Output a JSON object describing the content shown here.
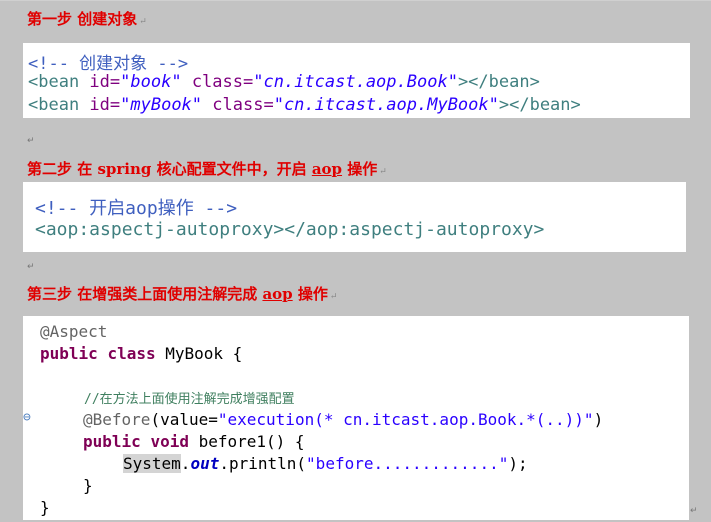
{
  "step1": {
    "heading": "第一步 创建对象",
    "code_comment": "<!-- 创建对象 -->",
    "bean1": {
      "open": "<bean ",
      "id_attr": "id=",
      "id_val": "\"book\"",
      "class_attr": "class=",
      "class_val": "\"cn.itcast.aop.Book\"",
      "close": "></bean>"
    },
    "bean2": {
      "open": "<bean ",
      "id_attr": "id=",
      "id_val": "\"myBook\"",
      "class_attr": "class=",
      "class_val": "\"cn.itcast.aop.MyBook\"",
      "close": "></bean>"
    }
  },
  "step2": {
    "heading_prefix": "第二步 在 spring 核心配置文件中，开启 ",
    "heading_link": "aop",
    "heading_suffix": " 操作",
    "code_comment": "<!-- 开启aop操作 -->",
    "code_line": "<aop:aspectj-autoproxy></aop:aspectj-autoproxy>"
  },
  "step3": {
    "heading_prefix": "第三步 在增强类上面使用注解完成 ",
    "heading_link": "aop",
    "heading_suffix": " 操作",
    "annotation": "@Aspect",
    "kw_public": "public",
    "kw_class": "class",
    "class_name": " MyBook {",
    "comment": "//在方法上面使用注解完成增强配置",
    "before_ann": "@Before",
    "before_args_open": "(value=",
    "before_value": "\"execution(* cn.itcast.aop.Book.*(..))\"",
    "before_args_close": ")",
    "kw_void": "void",
    "method_sig": " before1() {",
    "sys": "System",
    "dot1": ".",
    "out": "out",
    "println_open": ".println(",
    "print_str": "\"before.............\"",
    "println_close": ");",
    "close_method": "}",
    "close_class": "}"
  },
  "marks": {
    "return": "↵"
  }
}
